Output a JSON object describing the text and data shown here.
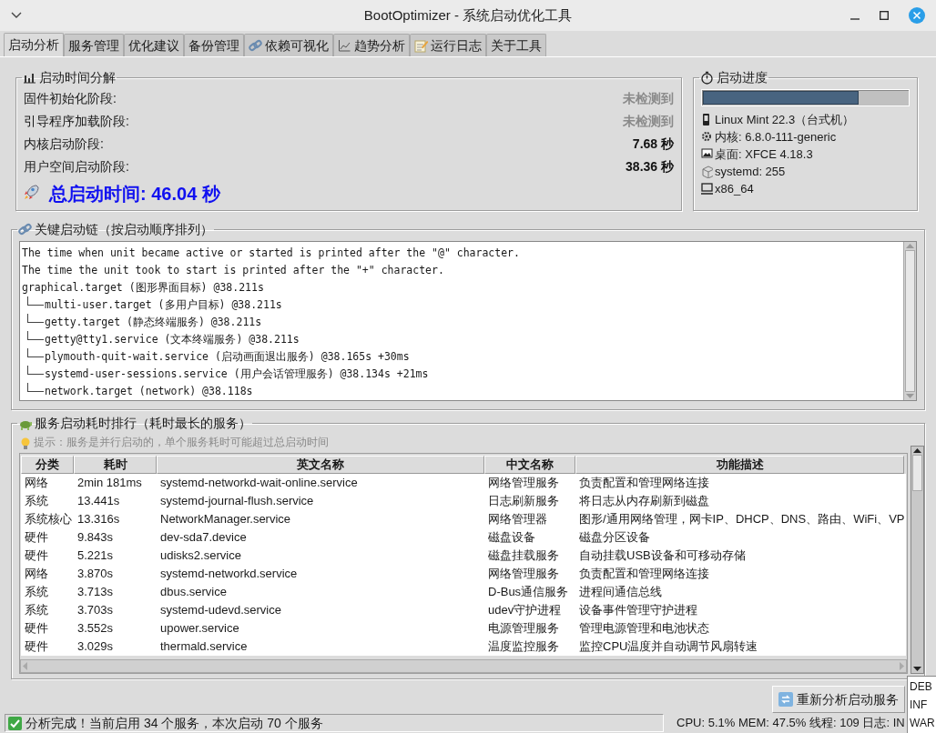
{
  "window": {
    "title": "BootOptimizer - 系统启动优化工具"
  },
  "tabs": [
    {
      "label": "启动分析",
      "selected": true
    },
    {
      "label": "服务管理",
      "selected": false
    },
    {
      "label": "优化建议",
      "selected": false
    },
    {
      "label": "备份管理",
      "selected": false
    },
    {
      "label": "依赖可视化",
      "selected": false
    },
    {
      "label": "趋势分析",
      "selected": false
    },
    {
      "label": "运行日志",
      "selected": false
    },
    {
      "label": "关于工具",
      "selected": false
    }
  ],
  "boot_breakdown": {
    "title": "启动时间分解",
    "stages": [
      {
        "label": "固件初始化阶段:",
        "value": "未检测到",
        "detected": false
      },
      {
        "label": "引导程序加载阶段:",
        "value": "未检测到",
        "detected": false
      },
      {
        "label": "内核启动阶段:",
        "value": "7.68 秒",
        "detected": true
      },
      {
        "label": "用户空间启动阶段:",
        "value": "38.36 秒",
        "detected": true
      }
    ],
    "total": "总启动时间: 46.04 秒"
  },
  "boot_progress": {
    "title": "启动进度",
    "level": 0.76,
    "info": [
      "Linux Mint 22.3（台式机）",
      "内核: 6.8.0-111-generic",
      "桌面: XFCE 4.18.3",
      "systemd: 255",
      "x86_64"
    ]
  },
  "critical_chain": {
    "title": "关键启动链（按启动顺序排列）",
    "header_lines": [
      "The time when unit became active or started is printed after the \"@\" character.",
      "The time the unit took to start is printed after the \"+\" character."
    ],
    "root": {
      "text": "graphical.target (图形界面目标) @38.211s",
      "children": [
        {
          "text": "multi-user.target (多用户目标) @38.211s"
        },
        {
          "text": "getty.target (静态终端服务) @38.211s"
        },
        {
          "text": "getty@tty1.service (文本终端服务) @38.211s"
        },
        {
          "text": "plymouth-quit-wait.service (启动画面退出服务) @38.165s +30ms"
        },
        {
          "text": "systemd-user-sessions.service (用户会话管理服务) @38.134s +21ms"
        },
        {
          "text": "network.target (network) @38.118s"
        }
      ]
    }
  },
  "service_ranking": {
    "title": "服务启动耗时排行（耗时最长的服务）",
    "hint": "提示：服务是并行启动的，单个服务耗时可能超过总启动时间",
    "columns": [
      "分类",
      "耗时",
      "英文名称",
      "中文名称",
      "功能描述"
    ],
    "rows": [
      [
        "网络",
        "2min 181ms",
        "systemd-networkd-wait-online.service",
        "网络管理服务",
        "负责配置和管理网络连接"
      ],
      [
        "系统",
        "13.441s",
        "systemd-journal-flush.service",
        "日志刷新服务",
        "将日志从内存刷新到磁盘"
      ],
      [
        "系统核心",
        "13.316s",
        "NetworkManager.service",
        "网络管理器",
        "图形/通用网络管理，网卡IP、DHCP、DNS、路由、WiFi、VP"
      ],
      [
        "硬件",
        "9.843s",
        "dev-sda7.device",
        "磁盘设备",
        "磁盘分区设备"
      ],
      [
        "硬件",
        "5.221s",
        "udisks2.service",
        "磁盘挂载服务",
        "自动挂载USB设备和可移动存储"
      ],
      [
        "网络",
        "3.870s",
        "systemd-networkd.service",
        "网络管理服务",
        "负责配置和管理网络连接"
      ],
      [
        "系统",
        "3.713s",
        "dbus.service",
        "D-Bus通信服务",
        "进程间通信总线"
      ],
      [
        "系统",
        "3.703s",
        "systemd-udevd.service",
        "udev守护进程",
        "设备事件管理守护进程"
      ],
      [
        "硬件",
        "3.552s",
        "upower.service",
        "电源管理服务",
        "管理电源管理和电池状态"
      ],
      [
        "硬件",
        "3.029s",
        "thermald.service",
        "温度监控服务",
        "监控CPU温度并自动调节风扇转速"
      ]
    ]
  },
  "reanalyze_button": "重新分析启动服务",
  "log_level_menu": [
    "DEB",
    "INF",
    "WAR"
  ],
  "status_bar": {
    "message": "分析完成！当前启用 34 个服务，本次启动 70 个服务",
    "stats": "CPU: 5.1%  MEM: 47.5%  线程: 109  日志: IN"
  }
}
